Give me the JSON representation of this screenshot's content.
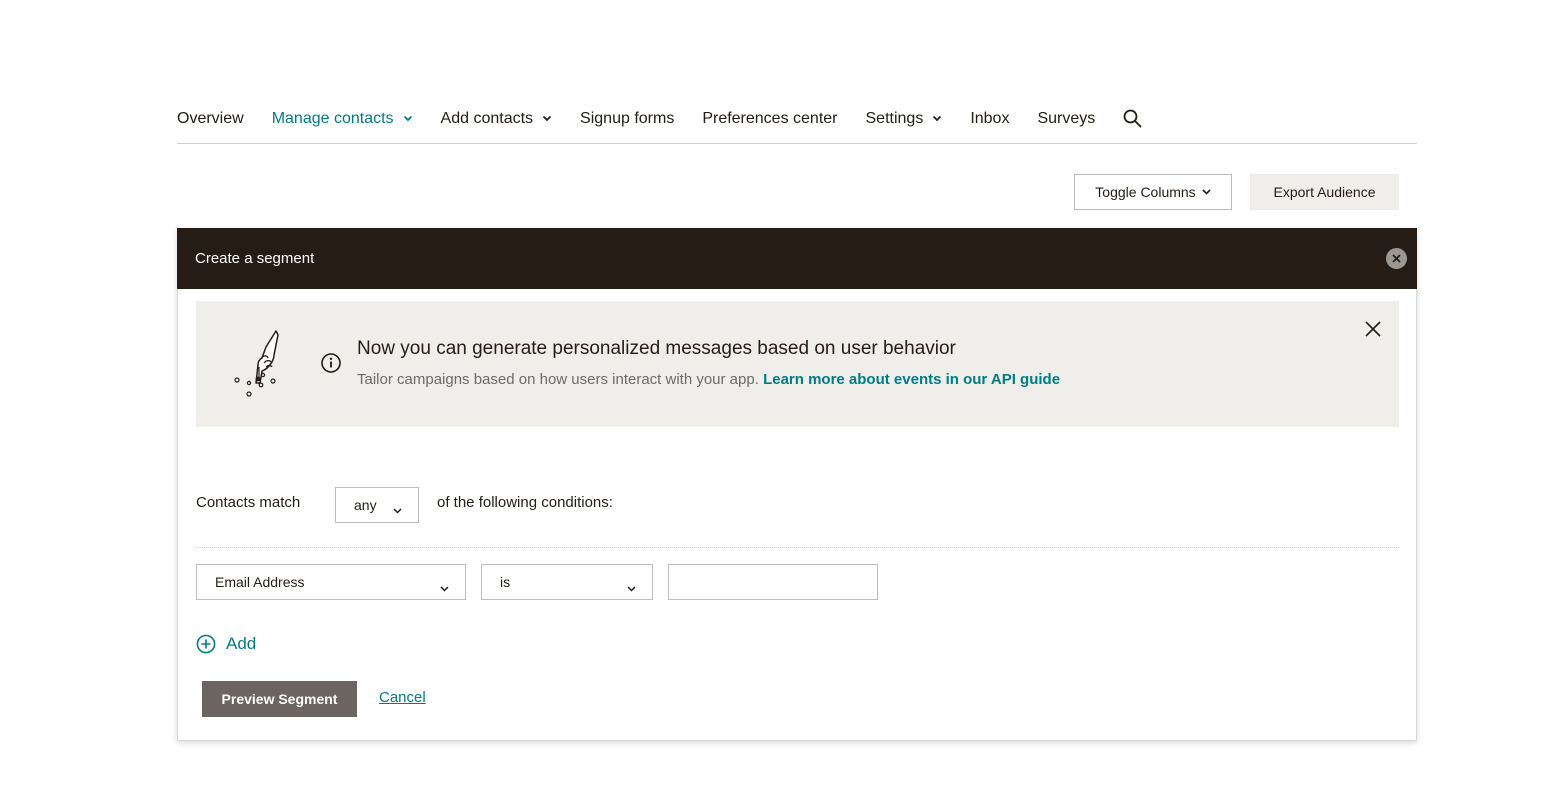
{
  "nav": {
    "items": [
      {
        "label": "Overview",
        "has_dropdown": false,
        "active": false
      },
      {
        "label": "Manage contacts",
        "has_dropdown": true,
        "active": true
      },
      {
        "label": "Add contacts",
        "has_dropdown": true,
        "active": false
      },
      {
        "label": "Signup forms",
        "has_dropdown": false,
        "active": false
      },
      {
        "label": "Preferences center",
        "has_dropdown": false,
        "active": false
      },
      {
        "label": "Settings",
        "has_dropdown": true,
        "active": false
      },
      {
        "label": "Inbox",
        "has_dropdown": false,
        "active": false
      },
      {
        "label": "Surveys",
        "has_dropdown": false,
        "active": false
      }
    ],
    "search_icon": "search-icon"
  },
  "toolbar": {
    "toggle_columns_label": "Toggle Columns",
    "export_label": "Export Audience"
  },
  "segment": {
    "title": "Create a segment",
    "banner": {
      "title": "Now you can generate personalized messages based on user behavior",
      "text": "Tailor campaigns based on how users interact with your app.",
      "link": "Learn more about events in our API guide"
    },
    "match_prefix": "Contacts match",
    "match_value": "any",
    "match_suffix": "of the following conditions:",
    "condition": {
      "field": "Email Address",
      "operator": "is",
      "value": ""
    },
    "add_label": "Add",
    "preview_label": "Preview Segment",
    "cancel_label": "Cancel"
  },
  "colors": {
    "accent": "#007c89",
    "header_bg": "#241c15",
    "banner_bg": "#efeeea",
    "preview_bg": "#6b6461"
  }
}
